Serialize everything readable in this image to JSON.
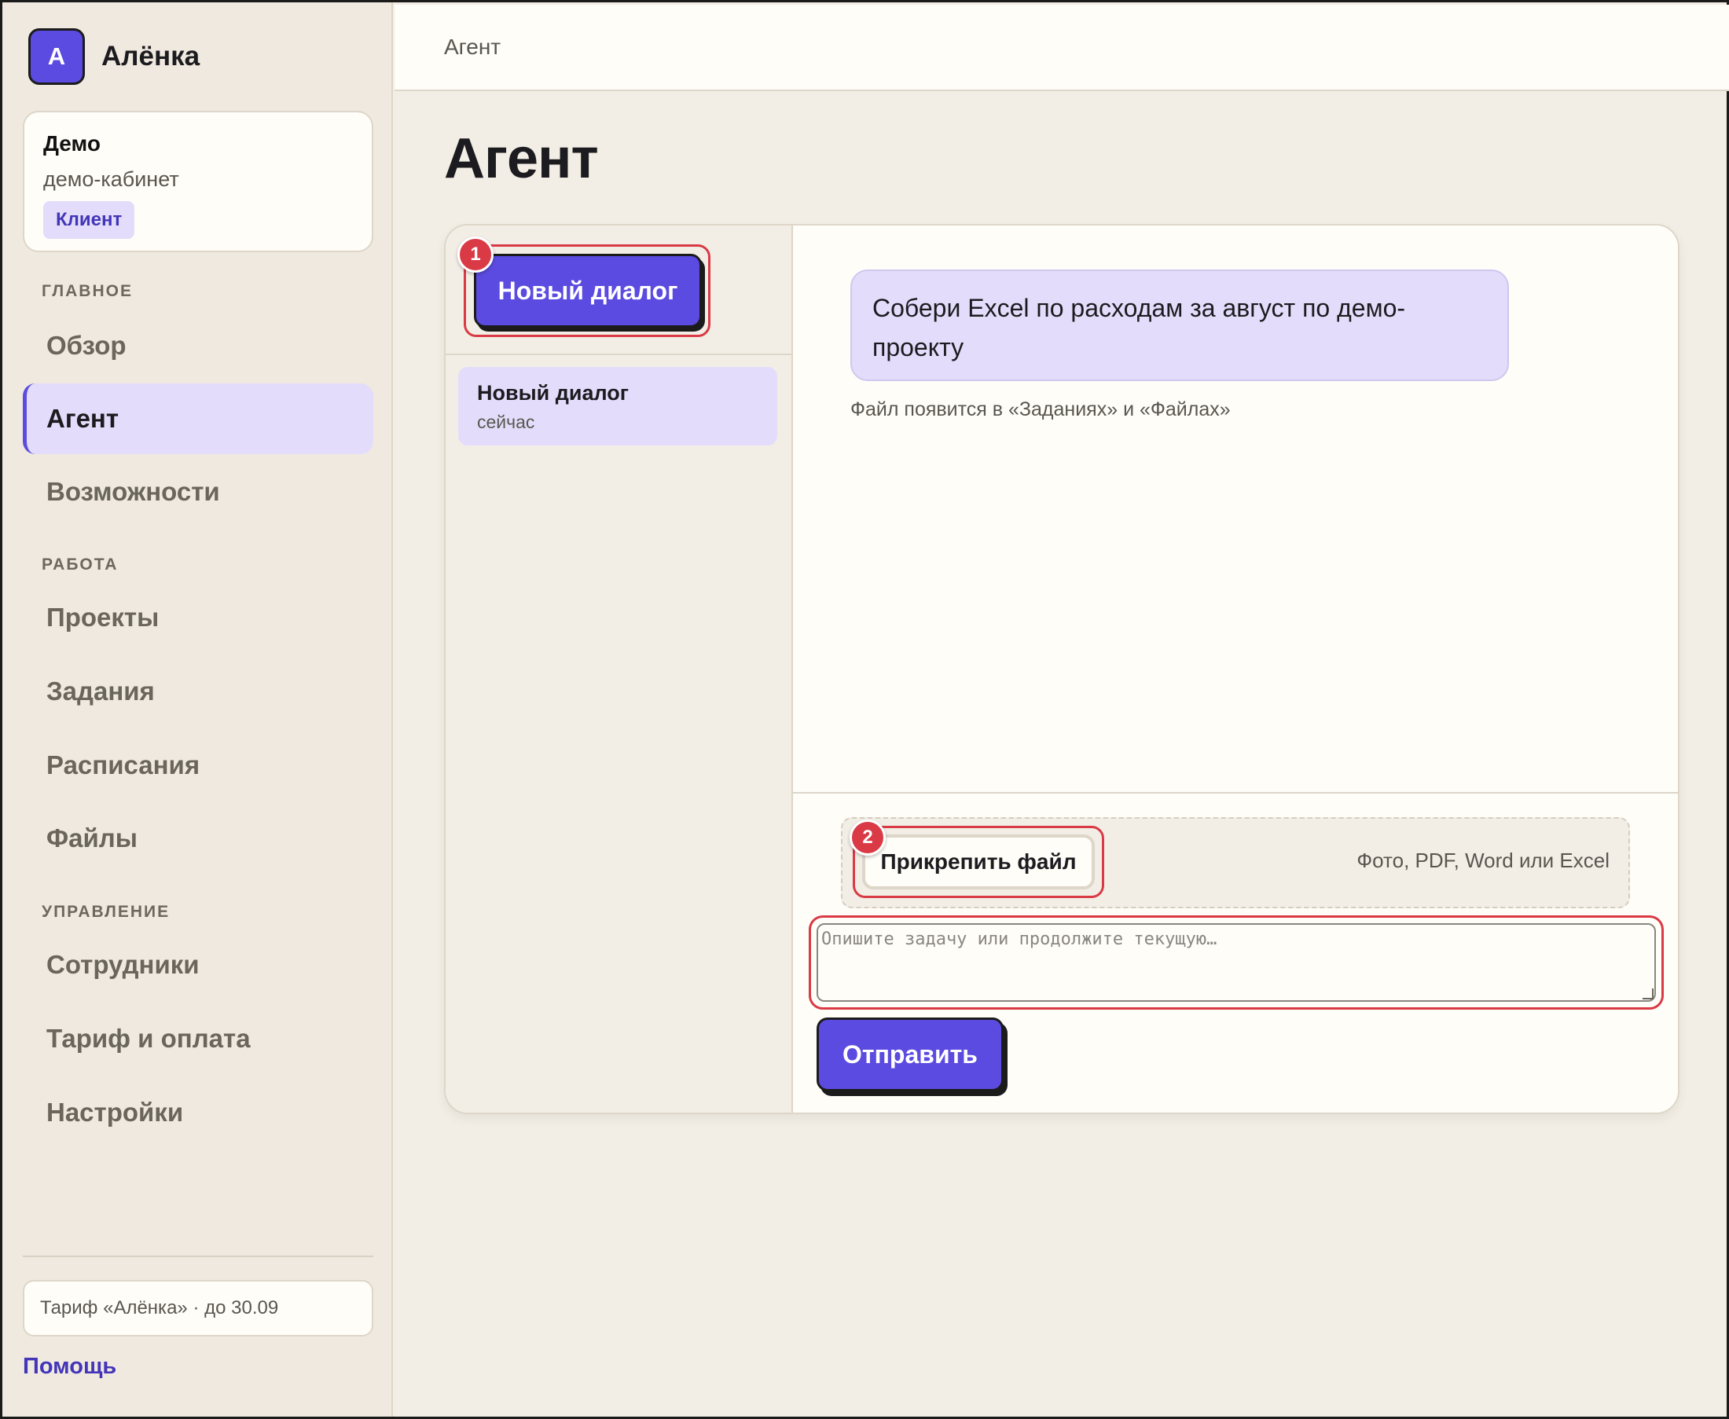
{
  "brand": {
    "logo_letter": "А",
    "name": "Алёнка",
    "accent": "#5b4be0"
  },
  "workspace": {
    "name": "Демо",
    "subtitle": "демо-кабинет",
    "role_badge": "Клиент"
  },
  "sidebar": {
    "sections": [
      {
        "label": "ГЛАВНОЕ",
        "items": [
          "Обзор",
          "Агент",
          "Возможности"
        ]
      },
      {
        "label": "РАБОТА",
        "items": [
          "Проекты",
          "Задания",
          "Расписания",
          "Файлы"
        ]
      },
      {
        "label": "УПРАВЛЕНИЕ",
        "items": [
          "Сотрудники",
          "Тариф и оплата",
          "Настройки"
        ]
      }
    ],
    "active_item": "Агент",
    "plan_text": "Тариф «Алёнка» · до 30.09",
    "help_link": "Помощь"
  },
  "topbar": {
    "breadcrumb": "Агент"
  },
  "page": {
    "title": "Агент"
  },
  "dialogs": {
    "new_dialog_label": "Новый диалог",
    "marker_new": "1",
    "items": [
      {
        "title": "Новый диалог",
        "time": "сейчас"
      }
    ]
  },
  "chat": {
    "message": "Собери Excel по расходам за август по демо-проекту",
    "note": "Файл появится в «Заданиях» и «Файлах»"
  },
  "composer": {
    "attach_label": "Прикрепить файл",
    "marker_attach": "2",
    "attach_hint": "Фото, PDF, Word или Excel",
    "input_value": "",
    "input_placeholder": "Опишите задачу или продолжите текущую…",
    "send_label": "Отправить"
  },
  "colors": {
    "highlight": "#d93a45",
    "active_bg": "#e3ddfb",
    "background": "#f2eee6"
  }
}
